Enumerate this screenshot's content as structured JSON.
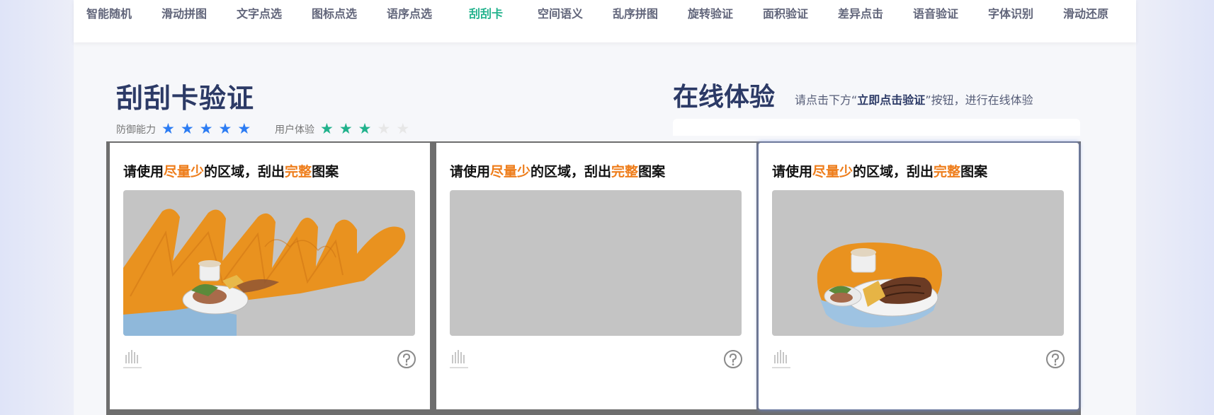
{
  "nav": {
    "items": [
      "智能随机",
      "滑动拼图",
      "文字点选",
      "图标点选",
      "语序点选",
      "刮刮卡",
      "空间语义",
      "乱序拼图",
      "旋转验证",
      "面积验证",
      "差异点击",
      "语音验证",
      "字体识别",
      "滑动还原"
    ],
    "active_index": 5
  },
  "product": {
    "title": "刮刮卡验证",
    "defense_label": "防御能力",
    "defense_stars": 5,
    "ux_label": "用户体验",
    "ux_stars": 3,
    "max_stars": 5
  },
  "online": {
    "title": "在线体验",
    "hint_prefix": "请点击下方“",
    "hint_bold": "立即点击验证",
    "hint_suffix": "”按钮，进行在线体验"
  },
  "captcha": {
    "prompt": [
      "请使用",
      "尽量少",
      "的区域，刮出",
      "完整",
      "图案"
    ],
    "cards": [
      {
        "state": "scratched-wide"
      },
      {
        "state": "unscratched"
      },
      {
        "state": "scratched-minimal",
        "selected": true
      }
    ]
  },
  "colors": {
    "accent_green": "#21b28c",
    "star_blue": "#2c7cf3",
    "highlight_orange": "#ee7d1b",
    "heading_navy": "#2c3a66"
  },
  "icons": {
    "logo": "dingxiang-logo-icon",
    "help": "question-circle-icon"
  }
}
